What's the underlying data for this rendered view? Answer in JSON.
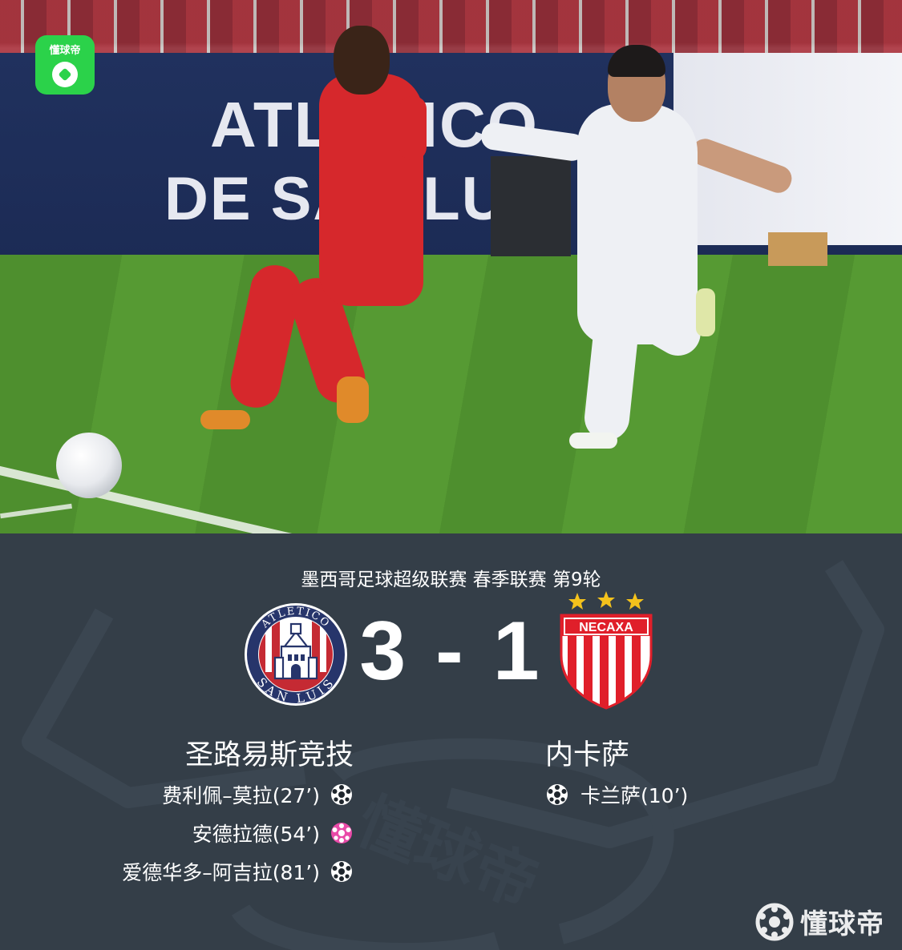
{
  "photo": {
    "watermark_label": "懂球帝",
    "board_line1": "ATLETICO",
    "board_line2": "DE SAN LUIS"
  },
  "match": {
    "competition": "墨西哥足球超级联赛 春季联赛 第9轮",
    "home": {
      "name": "圣路易斯竞技",
      "crest_text_top": "ATLETICO",
      "crest_text_bottom": "SAN LUIS",
      "score": "3",
      "scorers": [
        {
          "text": "费利佩–莫拉(27’)",
          "icon": "goal-icon",
          "color": "#ffffff"
        },
        {
          "text": "安德拉德(54’)",
          "icon": "penalty-goal-icon",
          "color": "#e94aa8"
        },
        {
          "text": "爱德华多–阿吉拉(81’)",
          "icon": "goal-icon",
          "color": "#ffffff"
        }
      ]
    },
    "separator": "-",
    "away": {
      "name": "内卡萨",
      "crest_text": "NECAXA",
      "score": "1",
      "scorers": [
        {
          "text": "卡兰萨(10’)",
          "icon": "goal-icon",
          "color": "#ffffff"
        }
      ]
    }
  },
  "brand": {
    "name": "懂球帝",
    "accent": "#2bd24a"
  },
  "colors": {
    "panel_bg": "#343e48",
    "home_crest_red": "#c52a33",
    "home_crest_navy": "#27356b",
    "away_crest_red": "#e01f2a",
    "star_gold": "#f4c21c"
  }
}
